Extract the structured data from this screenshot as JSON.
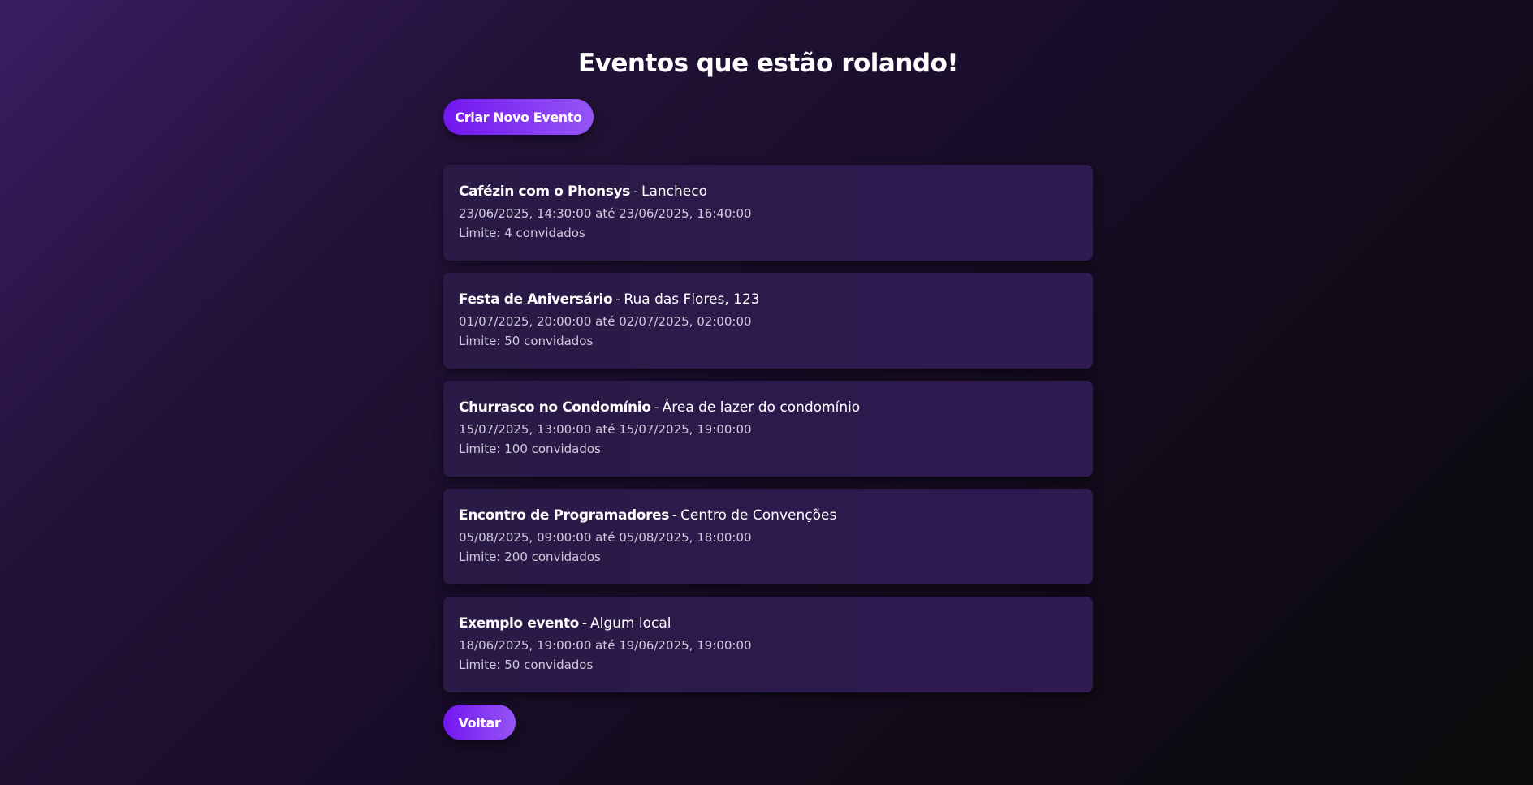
{
  "page": {
    "title": "Eventos que estão rolando!"
  },
  "actions": {
    "create_label": "Criar Novo Evento",
    "back_label": "Voltar"
  },
  "events": [
    {
      "name": "Cafézin com o Phonsys",
      "separator": "-",
      "place": "Lancheco",
      "when": "23/06/2025, 14:30:00 até 23/06/2025, 16:40:00",
      "limit": "Limite: 4 convidados"
    },
    {
      "name": "Festa de Aniversário",
      "separator": "-",
      "place": "Rua das Flores, 123",
      "when": "01/07/2025, 20:00:00 até 02/07/2025, 02:00:00",
      "limit": "Limite: 50 convidados"
    },
    {
      "name": "Churrasco no Condomínio",
      "separator": "-",
      "place": "Área de lazer do condomínio",
      "when": "15/07/2025, 13:00:00 até 15/07/2025, 19:00:00",
      "limit": "Limite: 100 convidados"
    },
    {
      "name": "Encontro de Programadores",
      "separator": "-",
      "place": "Centro de Convenções",
      "when": "05/08/2025, 09:00:00 até 05/08/2025, 18:00:00",
      "limit": "Limite: 200 convidados"
    },
    {
      "name": "Exemplo evento",
      "separator": "-",
      "place": "Algum local",
      "when": "18/06/2025, 19:00:00 até 19/06/2025, 19:00:00",
      "limit": "Limite: 50 convidados"
    }
  ],
  "colors": {
    "accent_start": "#7316f0",
    "accent_end": "#9555f5",
    "card_background": "#2c1a4a",
    "text_primary": "#ffffff",
    "text_secondary": "#d2c8de"
  }
}
